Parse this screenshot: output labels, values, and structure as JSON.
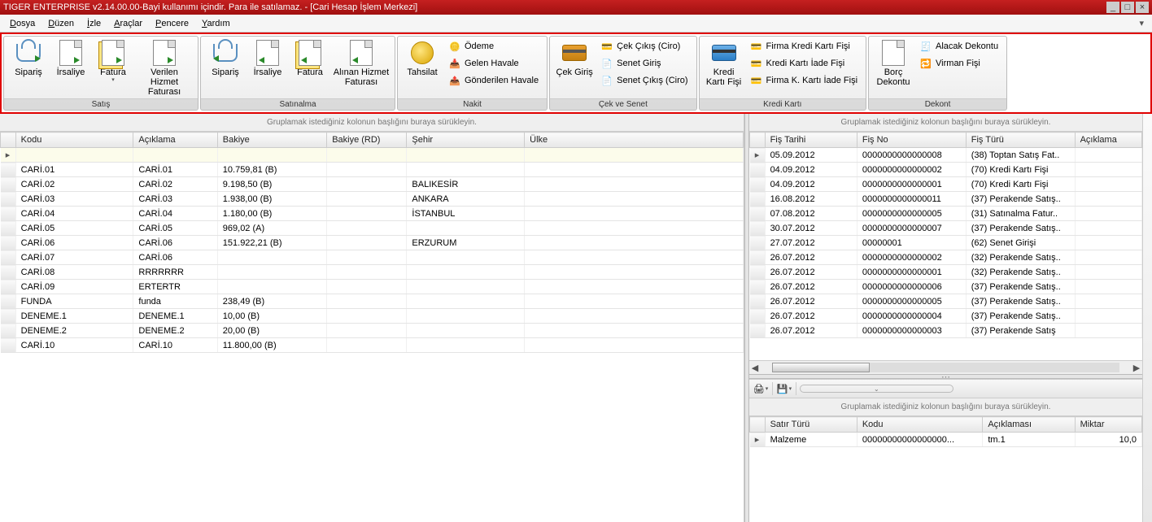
{
  "window": {
    "title": "TIGER ENTERPRISE v2.14.00.00-Bayi kullanımı içindir. Para ile satılamaz. - [Cari Hesap İşlem Merkezi]"
  },
  "menu": {
    "items": [
      "Dosya",
      "Düzen",
      "İzle",
      "Araçlar",
      "Pencere",
      "Yardım"
    ]
  },
  "ribbon": {
    "groups": [
      {
        "title": "Satış",
        "buttons": [
          {
            "label": "Sipariş",
            "icon": "basket"
          },
          {
            "label": "İrsaliye",
            "icon": "doc"
          },
          {
            "label": "Fatura",
            "icon": "doc-stack",
            "hasDropdown": true
          },
          {
            "label": "Verilen Hizmet Faturası",
            "icon": "doc-arrow"
          }
        ]
      },
      {
        "title": "Satınalma",
        "buttons": [
          {
            "label": "Sipariş",
            "icon": "basket"
          },
          {
            "label": "İrsaliye",
            "icon": "doc"
          },
          {
            "label": "Fatura",
            "icon": "doc-stack"
          },
          {
            "label": "Alınan Hizmet Faturası",
            "icon": "doc-arrow-in"
          }
        ]
      },
      {
        "title": "Nakit",
        "mainButtons": [
          {
            "label": "Tahsilat",
            "icon": "coins"
          }
        ],
        "smallButtons": [
          {
            "label": "Ödeme",
            "icon": "coins-sm"
          },
          {
            "label": "Gelen Havale",
            "icon": "havale-in"
          },
          {
            "label": "Gönderilen Havale",
            "icon": "havale-out"
          }
        ]
      },
      {
        "title": "Çek ve Senet",
        "mainButtons": [
          {
            "label": "Çek Giriş",
            "icon": "card"
          }
        ],
        "smallButtons": [
          {
            "label": "Çek Çıkış (Ciro)",
            "icon": "card-sm"
          },
          {
            "label": "Senet Giriş",
            "icon": "senet"
          },
          {
            "label": "Senet Çıkış (Ciro)",
            "icon": "senet-out"
          }
        ]
      },
      {
        "title": "Kredi Kartı",
        "mainButtons": [
          {
            "label": "Kredi Kartı Fişi",
            "icon": "ccard"
          }
        ],
        "smallButtons": [
          {
            "label": "Firma Kredi Kartı Fişi",
            "icon": "ccard-sm"
          },
          {
            "label": "Kredi Kartı İade Fişi",
            "icon": "ccard-ret"
          },
          {
            "label": "Firma K. Kartı İade Fişi",
            "icon": "ccard-fret"
          }
        ]
      },
      {
        "title": "Dekont",
        "mainButtons": [
          {
            "label": "Borç Dekontu",
            "icon": "dekont"
          }
        ],
        "smallButtons": [
          {
            "label": "Alacak Dekontu",
            "icon": "alacak"
          },
          {
            "label": "Virman Fişi",
            "icon": "virman"
          }
        ]
      }
    ]
  },
  "groupHint": "Gruplamak istediğiniz kolonun başlığını buraya sürükleyin.",
  "leftGrid": {
    "columns": [
      "Kodu",
      "Açıklama",
      "Bakiye",
      "Bakiye (RD)",
      "Şehir",
      "Ülke"
    ],
    "rows": [
      [
        "CARİ.01",
        "CARİ.01",
        "10.759,81 (B)",
        "",
        "",
        ""
      ],
      [
        "CARİ.02",
        "CARİ.02",
        "9.198,50 (B)",
        "",
        "BALIKESİR",
        ""
      ],
      [
        "CARİ.03",
        "CARİ.03",
        "1.938,00 (B)",
        "",
        "ANKARA",
        ""
      ],
      [
        "CARİ.04",
        "CARİ.04",
        "1.180,00 (B)",
        "",
        "İSTANBUL",
        ""
      ],
      [
        "CARİ.05",
        "CARİ.05",
        "969,02 (A)",
        "",
        "",
        ""
      ],
      [
        "CARİ.06",
        "CARİ.06",
        "151.922,21 (B)",
        "",
        "ERZURUM",
        ""
      ],
      [
        "CARİ.07",
        "CARİ.06",
        "",
        "",
        "",
        ""
      ],
      [
        "CARİ.08",
        "RRRRRRR",
        "",
        "",
        "",
        ""
      ],
      [
        "CARİ.09",
        "ERTERTR",
        "",
        "",
        "",
        ""
      ],
      [
        "FUNDA",
        "funda",
        "238,49 (B)",
        "",
        "",
        ""
      ],
      [
        "DENEME.1",
        "DENEME.1",
        "10,00 (B)",
        "",
        "",
        ""
      ],
      [
        "DENEME.2",
        "DENEME.2",
        "20,00 (B)",
        "",
        "",
        ""
      ],
      [
        "CARİ.10",
        "CARİ.10",
        "11.800,00 (B)",
        "",
        "",
        ""
      ]
    ]
  },
  "rightTopGrid": {
    "columns": [
      "Fiş Tarihi",
      "Fiş No",
      "Fiş Türü",
      "Açıklama"
    ],
    "rows": [
      [
        "05.09.2012",
        "0000000000000008",
        "(38) Toptan Satış Fat..",
        ""
      ],
      [
        "04.09.2012",
        "0000000000000002",
        "(70) Kredi Kartı Fişi",
        ""
      ],
      [
        "04.09.2012",
        "0000000000000001",
        "(70) Kredi Kartı Fişi",
        ""
      ],
      [
        "16.08.2012",
        "0000000000000011",
        "(37) Perakende Satış..",
        ""
      ],
      [
        "07.08.2012",
        "0000000000000005",
        "(31) Satınalma Fatur..",
        ""
      ],
      [
        "30.07.2012",
        "0000000000000007",
        "(37) Perakende Satış..",
        ""
      ],
      [
        "27.07.2012",
        "00000001",
        "(62) Senet Girişi",
        ""
      ],
      [
        "26.07.2012",
        "0000000000000002",
        "(32) Perakende Satış..",
        ""
      ],
      [
        "26.07.2012",
        "0000000000000001",
        "(32) Perakende Satış..",
        ""
      ],
      [
        "26.07.2012",
        "0000000000000006",
        "(37) Perakende Satış..",
        ""
      ],
      [
        "26.07.2012",
        "0000000000000005",
        "(37) Perakende Satış..",
        ""
      ],
      [
        "26.07.2012",
        "0000000000000004",
        "(37) Perakende Satış..",
        ""
      ],
      [
        "26.07.2012",
        "0000000000000003",
        "(37) Perakende Satış",
        ""
      ]
    ]
  },
  "rightBottomGrid": {
    "columns": [
      "Satır Türü",
      "Kodu",
      "Açıklaması",
      "Miktar"
    ],
    "rows": [
      [
        "Malzeme",
        "00000000000000000...",
        "tm.1",
        "10,0"
      ]
    ]
  }
}
